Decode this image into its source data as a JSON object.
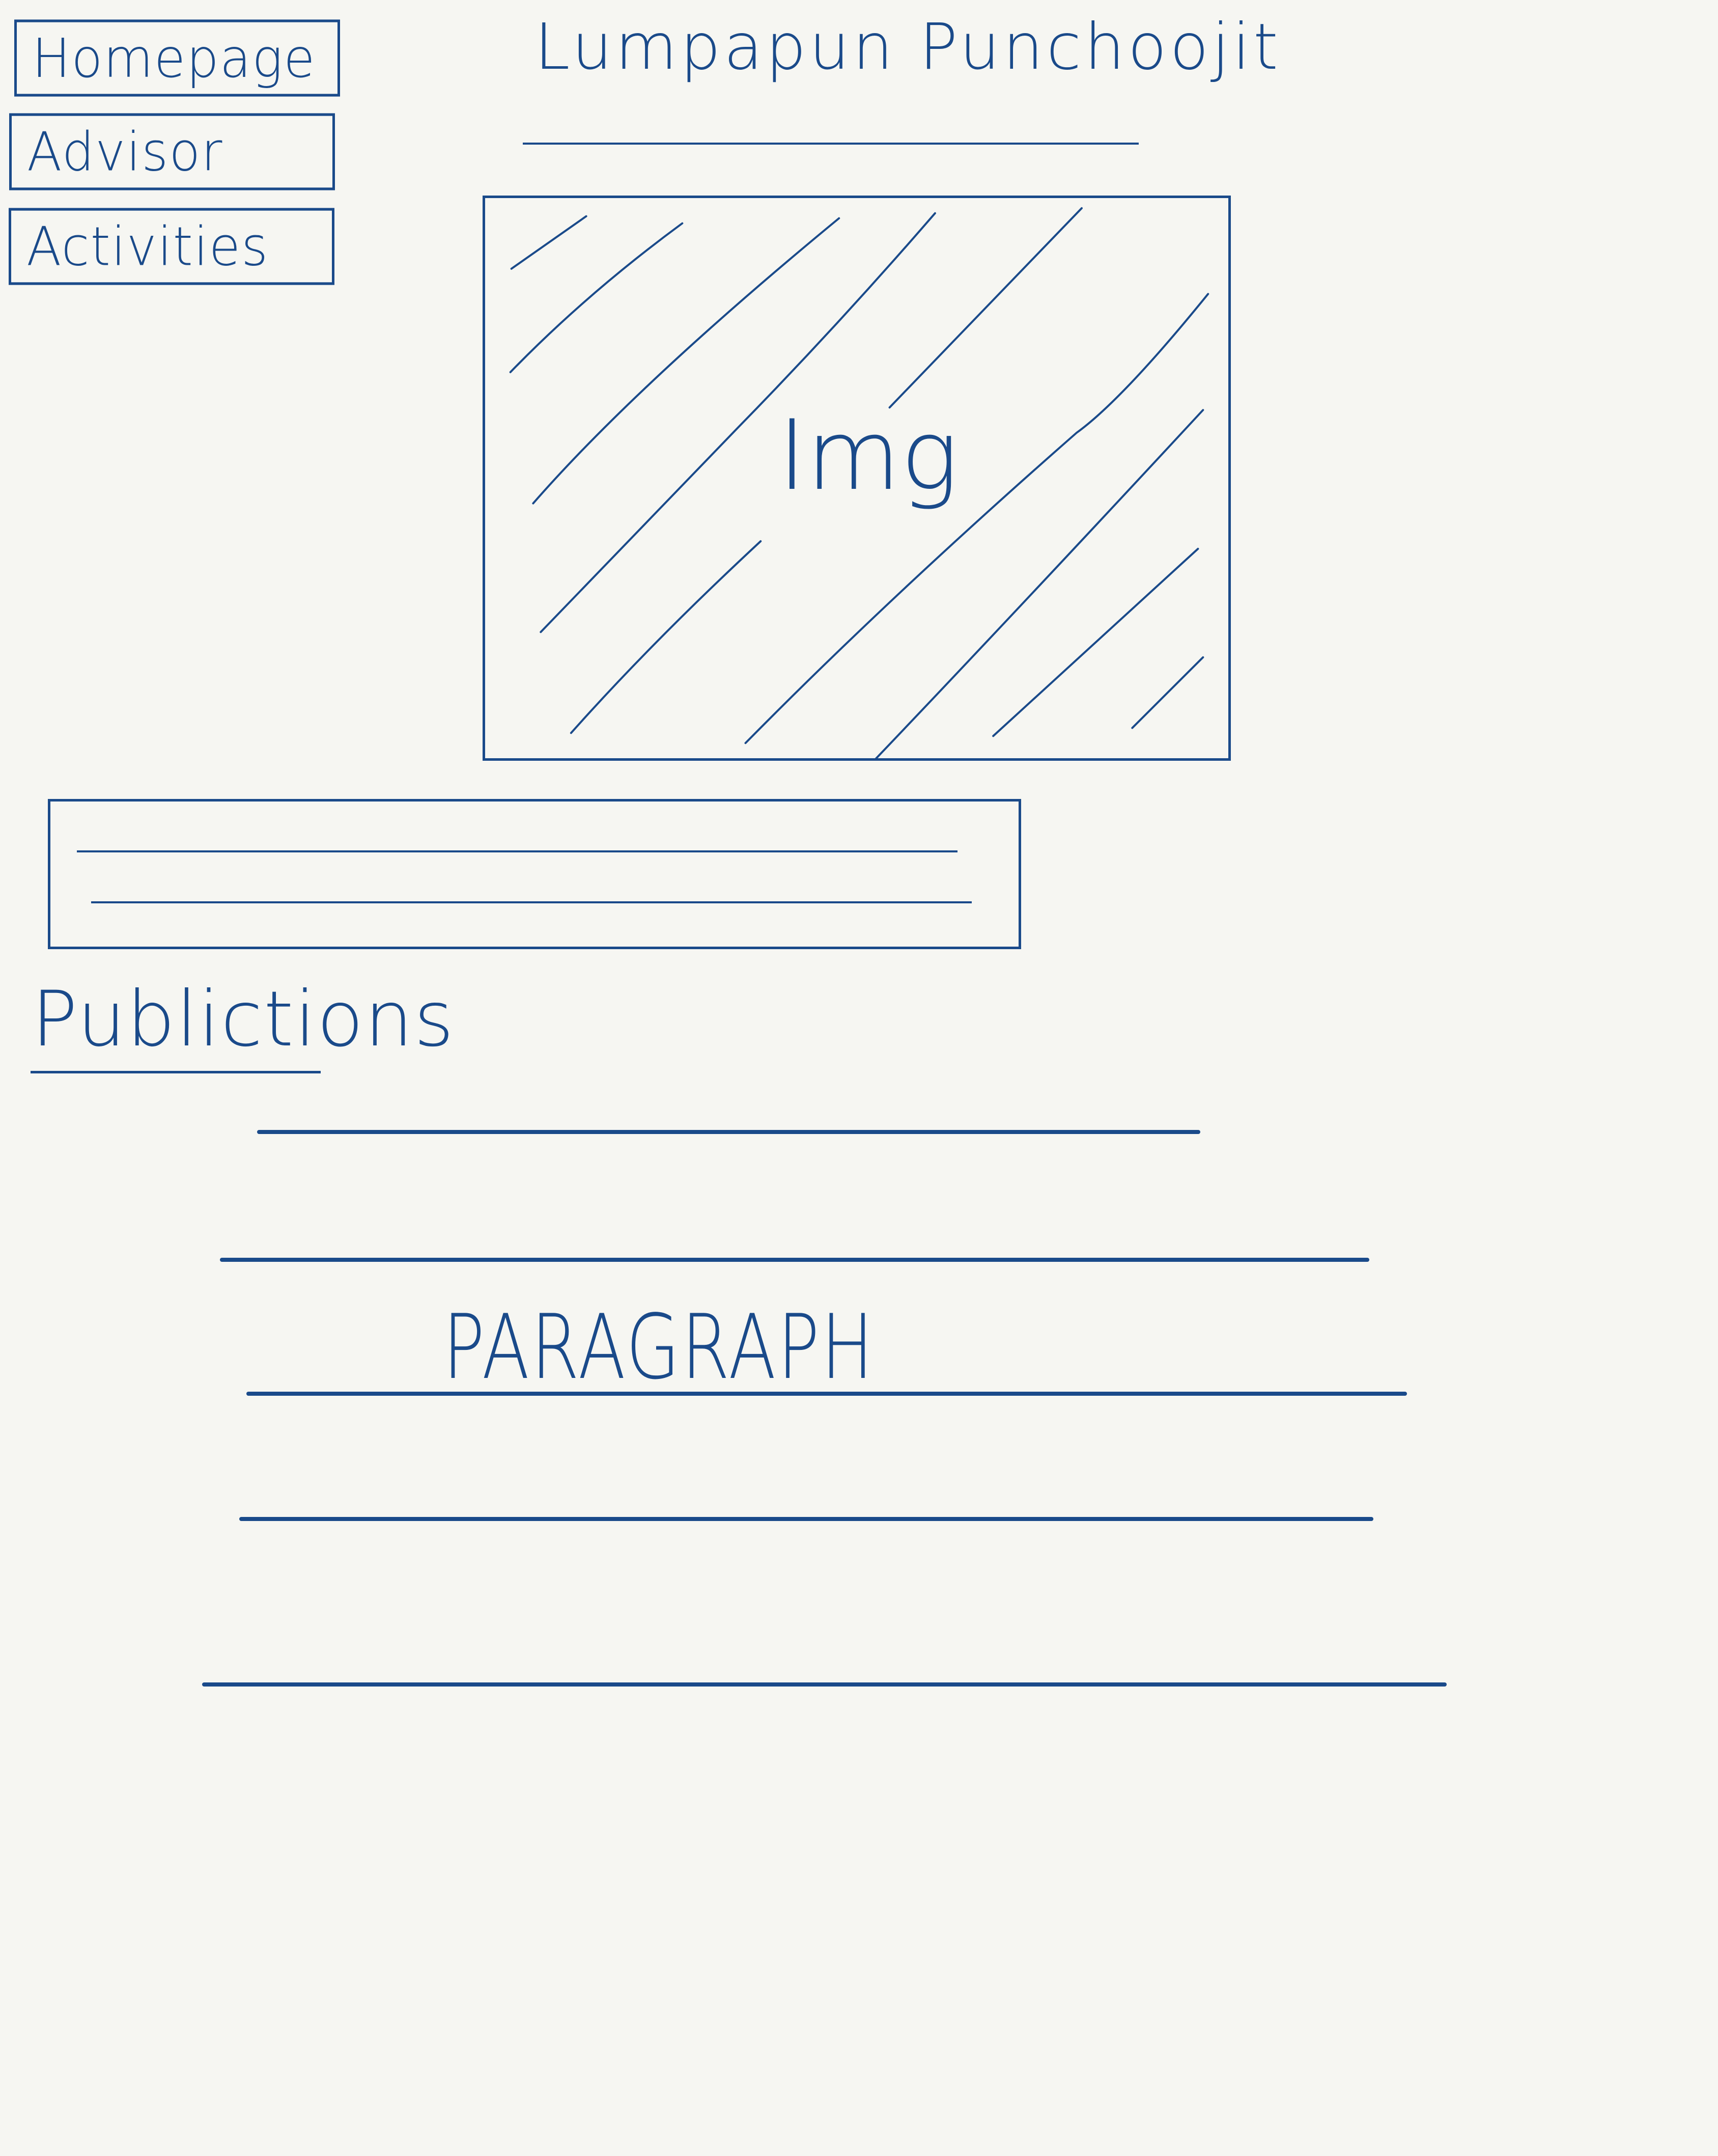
{
  "nav": {
    "items": [
      {
        "label": "Homepage"
      },
      {
        "label": "Advisor"
      },
      {
        "label": "Activities"
      }
    ]
  },
  "header": {
    "title": "Lumpapun   Punchoojit"
  },
  "hero_image": {
    "label": "Img"
  },
  "publications": {
    "heading": "Publictions",
    "placeholder": "PARAGRAPH"
  },
  "colors": {
    "ink": "#1a4a8a",
    "background": "#f6f6f2"
  }
}
